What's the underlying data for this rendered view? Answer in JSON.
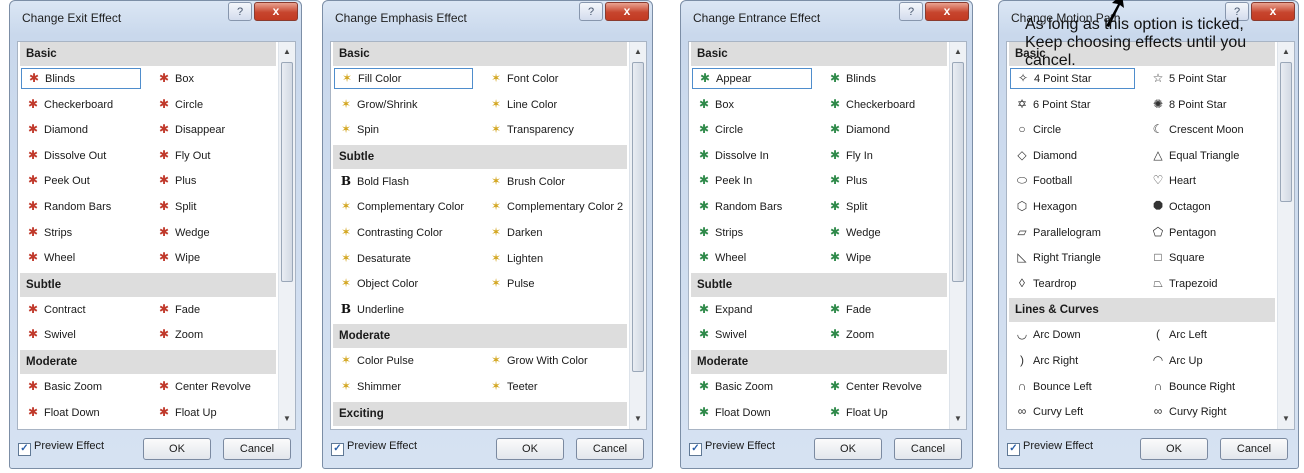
{
  "dialogs": [
    {
      "id": "exit",
      "title": "Change Exit Effect",
      "icon_type": "exit",
      "sections": [
        {
          "label": "Basic",
          "items": [
            "Blinds",
            "Box",
            "Checkerboard",
            "Circle",
            "Diamond",
            "Disappear",
            "Dissolve Out",
            "Fly Out",
            "Peek Out",
            "Plus",
            "Random Bars",
            "Split",
            "Strips",
            "Wedge",
            "Wheel",
            "Wipe"
          ]
        },
        {
          "label": "Subtle",
          "items": [
            "Contract",
            "Fade",
            "Swivel",
            "Zoom"
          ]
        },
        {
          "label": "Moderate",
          "items": [
            "Basic Zoom",
            "Center Revolve",
            "Float Down",
            "Float Up"
          ]
        }
      ],
      "selected": "Blinds",
      "preview_label": "Preview Effect",
      "ok_label": "OK",
      "cancel_label": "Cancel"
    },
    {
      "id": "emphasis",
      "title": "Change Emphasis Effect",
      "icon_type": "emph",
      "sections": [
        {
          "label": "Basic",
          "items": [
            "Fill Color",
            "Font Color",
            "Grow/Shrink",
            "Line Color",
            "Spin",
            "Transparency"
          ]
        },
        {
          "label": "Subtle",
          "items": [
            "Bold Flash",
            "Brush Color",
            "Complementary Color",
            "Complementary Color 2",
            "Contrasting Color",
            "Darken",
            "Desaturate",
            "Lighten",
            "Object Color",
            "Pulse",
            "Underline"
          ]
        },
        {
          "label": "Moderate",
          "items": [
            "Color Pulse",
            "Grow With Color",
            "Shimmer",
            "Teeter"
          ]
        },
        {
          "label": "Exciting",
          "items": []
        }
      ],
      "selected": "Fill Color",
      "preview_label": "Preview Effect",
      "ok_label": "OK",
      "cancel_label": "Cancel"
    },
    {
      "id": "entrance",
      "title": "Change Entrance Effect",
      "icon_type": "ent",
      "sections": [
        {
          "label": "Basic",
          "items": [
            "Appear",
            "Blinds",
            "Box",
            "Checkerboard",
            "Circle",
            "Diamond",
            "Dissolve In",
            "Fly In",
            "Peek In",
            "Plus",
            "Random Bars",
            "Split",
            "Strips",
            "Wedge",
            "Wheel",
            "Wipe"
          ]
        },
        {
          "label": "Subtle",
          "items": [
            "Expand",
            "Fade",
            "Swivel",
            "Zoom"
          ]
        },
        {
          "label": "Moderate",
          "items": [
            "Basic Zoom",
            "Center Revolve",
            "Float Down",
            "Float Up"
          ]
        }
      ],
      "selected": "Appear",
      "preview_label": "Preview Effect",
      "ok_label": "OK",
      "cancel_label": "Cancel"
    },
    {
      "id": "motion",
      "title": "Change Motion Path",
      "icon_type": "path",
      "sections": [
        {
          "label": "Basic",
          "items": [
            "4 Point Star",
            "5 Point Star",
            "6 Point Star",
            "8 Point Star",
            "Circle",
            "Crescent Moon",
            "Diamond",
            "Equal Triangle",
            "Football",
            "Heart",
            "Hexagon",
            "Octagon",
            "Parallelogram",
            "Pentagon",
            "Right Triangle",
            "Square",
            "Teardrop",
            "Trapezoid"
          ]
        },
        {
          "label": "Lines & Curves",
          "items": [
            "Arc Down",
            "Arc Left",
            "Arc Right",
            "Arc Up",
            "Bounce Left",
            "Bounce Right",
            "Curvy Left",
            "Curvy Right"
          ]
        }
      ],
      "selected": "4 Point Star",
      "preview_label": "Preview Effect",
      "ok_label": "OK",
      "cancel_label": "Cancel"
    }
  ],
  "annotation": {
    "lines": [
      "As long as this option is ticked,",
      "Keep choosing effects until you",
      "cancel."
    ]
  },
  "glyphs": {
    "help": "?",
    "close": "x",
    "check": "✓",
    "scroll_up": "▲",
    "scroll_down": "▼"
  },
  "colors": {
    "section_bg": "#dddddd",
    "selection_border": "#4f8dcc",
    "exit_icon": "#c0392b",
    "entrance_icon": "#2f8a4a",
    "emphasis_icon": "#d3a61f"
  }
}
